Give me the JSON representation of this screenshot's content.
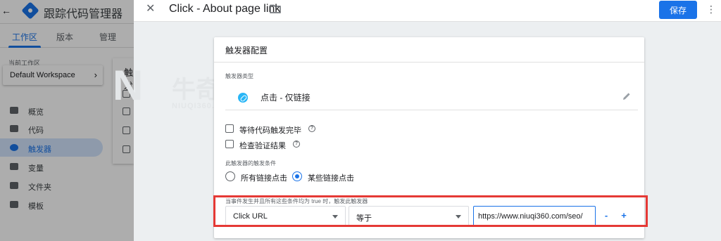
{
  "app": {
    "title": "跟踪代码管理器",
    "tabs": [
      "工作区",
      "版本",
      "管理"
    ],
    "workspace_label": "当前工作区",
    "workspace_name": "Default Workspace",
    "nav": [
      {
        "label": "概览",
        "icon": "overview-icon"
      },
      {
        "label": "代码",
        "icon": "tag-icon"
      },
      {
        "label": "触发器",
        "icon": "trigger-icon"
      },
      {
        "label": "变量",
        "icon": "variable-icon"
      },
      {
        "label": "文件夹",
        "icon": "folder-icon"
      },
      {
        "label": "模板",
        "icon": "template-icon"
      }
    ],
    "active_nav": "触发器",
    "triggers_panel_title": "触发"
  },
  "sheet": {
    "title": "Click - About page link",
    "save_label": "保存"
  },
  "watermark": {
    "cn": "牛奇网",
    "url": "NIUQI360.COM"
  },
  "card": {
    "title": "触发器配置",
    "type_label": "触发器类型",
    "type_name": "点击 - 仅链接",
    "checkboxes": [
      {
        "label": "等待代码触发完毕",
        "checked": false
      },
      {
        "label": "检查验证结果",
        "checked": false
      }
    ],
    "fire_on_label": "此触发器的触发条件",
    "radios": [
      {
        "label": "所有链接点击",
        "selected": false
      },
      {
        "label": "某些链接点击",
        "selected": true
      }
    ],
    "condition_text": "当事件发生并且所有这些条件均为 true 时，触发此触发器",
    "condition": {
      "variable": "Click URL",
      "operator": "等于",
      "value": "https://www.niuqi360.com/seo/"
    },
    "minus": "-",
    "plus": "+"
  },
  "colors": {
    "accent": "#1a73e8",
    "highlight_box": "#e53935",
    "link_icon": "#29b6f6"
  }
}
